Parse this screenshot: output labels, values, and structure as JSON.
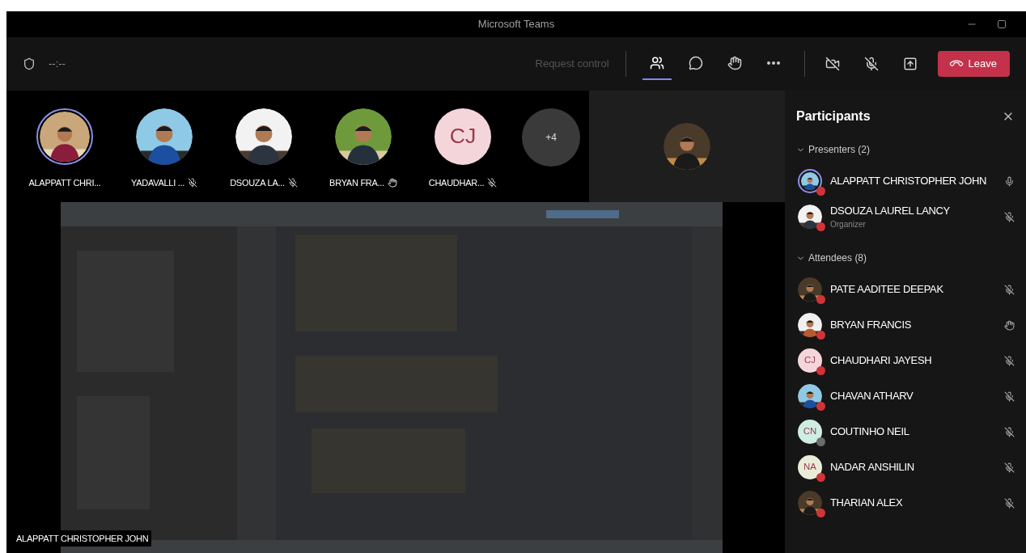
{
  "window": {
    "title": "Microsoft Teams"
  },
  "toolbar": {
    "timer": "--:--",
    "request_control": {
      "label": "Request control",
      "disabled": true
    },
    "tools": [
      {
        "kind": "people",
        "selected": true
      },
      {
        "kind": "chat",
        "selected": false
      },
      {
        "kind": "reactions",
        "selected": false
      },
      {
        "kind": "more",
        "selected": false
      }
    ],
    "media": [
      {
        "kind": "camera",
        "on": false
      },
      {
        "kind": "mic",
        "on": false
      },
      {
        "kind": "share",
        "on": false
      }
    ],
    "leave": "Leave"
  },
  "gallery": {
    "tiles": [
      {
        "name": "ALAPPATT CHRI...",
        "speaking": true,
        "muted": false,
        "hand_raised": false
      },
      {
        "name": "YADAVALLI ...",
        "speaking": false,
        "muted": true,
        "hand_raised": false
      },
      {
        "name": "DSOUZA LA...",
        "speaking": false,
        "muted": true,
        "hand_raised": false
      },
      {
        "name": "BRYAN FRA...",
        "speaking": false,
        "hand_raised": true
      },
      {
        "name": "CHAUDHAR...",
        "speaking": false,
        "avatar": {
          "kind": "initials",
          "text": "CJ",
          "color": "#f4d6da"
        },
        "muted": true,
        "hand_raised": false
      }
    ],
    "overflow": "+4"
  },
  "shared_screen": {
    "kind": "picture",
    "presenter": "ALAPPATT CHRISTOPHER JOHN"
  },
  "participants": {
    "title": "Participants",
    "sections": [
      {
        "title": "Presenters (2)",
        "expanded": true,
        "people": [
          {
            "name": "ALAPPATT CHRISTOPHER JOHN",
            "ringed": true,
            "color": "#d13438",
            "muted": false,
            "hand_raised": false
          },
          {
            "name": "DSOUZA LAUREL LANCY",
            "role": "Organizer",
            "ringed": false,
            "color": "#d13438",
            "muted": true,
            "hand_raised": false
          }
        ]
      },
      {
        "title": "Attendees (8)",
        "expanded": true,
        "people": [
          {
            "name": "PATE AADITEE DEEPAK",
            "ringed": false,
            "color": "#d13438",
            "muted": true,
            "hand_raised": false
          },
          {
            "name": "BRYAN FRANCIS",
            "ringed": false,
            "color": "#d13438",
            "hand_raised": true
          },
          {
            "name": "CHAUDHARI JAYESH",
            "avatar": {
              "kind": "initials",
              "text": "CJ",
              "color": "#f4d6da"
            },
            "ringed": false,
            "color": "#d13438",
            "muted": true,
            "hand_raised": false
          },
          {
            "name": "CHAVAN ATHARV",
            "ringed": false,
            "color": "#d13438",
            "muted": true,
            "hand_raised": false
          },
          {
            "name": "COUTINHO NEIL",
            "avatar": {
              "kind": "initials",
              "text": "CN",
              "color": "#cfeee3"
            },
            "ringed": false,
            "color": "#6b6b6b",
            "muted": true,
            "hand_raised": false
          },
          {
            "name": "NADAR ANSHILIN",
            "avatar": {
              "kind": "initials",
              "text": "NA",
              "color": "#e9ecd8"
            },
            "ringed": false,
            "color": "#d13438",
            "muted": true,
            "hand_raised": false
          },
          {
            "name": "THARIAN ALEX",
            "ringed": false,
            "color": "#d13438",
            "muted": true,
            "hand_raised": false
          }
        ]
      }
    ]
  }
}
